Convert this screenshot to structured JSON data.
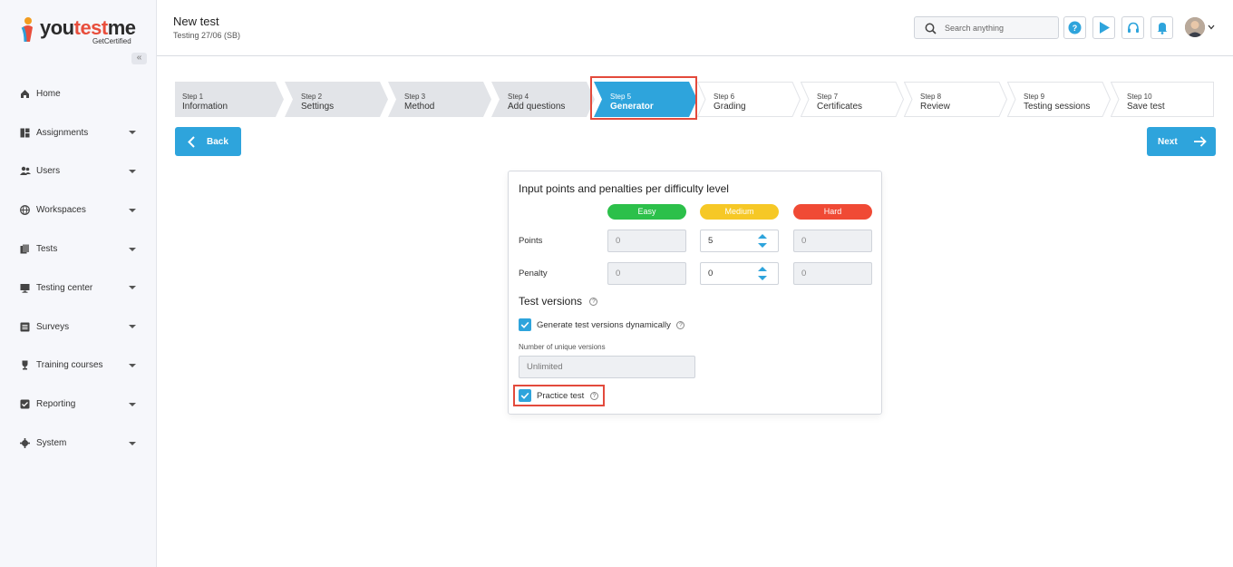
{
  "brand": {
    "word_dark": "you",
    "word_red": "test",
    "word_dark2": "me",
    "tagline": "GetCertified"
  },
  "sidebar": {
    "collapse_icon": "«",
    "items": [
      {
        "label": "Home",
        "icon": "home-icon",
        "has_caret": false
      },
      {
        "label": "Assignments",
        "icon": "assignments-icon",
        "has_caret": true
      },
      {
        "label": "Users",
        "icon": "users-icon",
        "has_caret": true
      },
      {
        "label": "Workspaces",
        "icon": "globe-icon",
        "has_caret": true
      },
      {
        "label": "Tests",
        "icon": "tests-icon",
        "has_caret": true
      },
      {
        "label": "Testing center",
        "icon": "monitor-icon",
        "has_caret": true
      },
      {
        "label": "Surveys",
        "icon": "surveys-icon",
        "has_caret": true
      },
      {
        "label": "Training courses",
        "icon": "trophy-icon",
        "has_caret": true
      },
      {
        "label": "Reporting",
        "icon": "reporting-icon",
        "has_caret": true
      },
      {
        "label": "System",
        "icon": "gear-icon",
        "has_caret": true
      }
    ]
  },
  "header": {
    "title": "New test",
    "subtitle": "Testing 27/06 (SB)",
    "search_placeholder": "Search anything"
  },
  "stepper": {
    "active_index": 4,
    "steps": [
      {
        "num": "Step 1",
        "name": "Information"
      },
      {
        "num": "Step 2",
        "name": "Settings"
      },
      {
        "num": "Step 3",
        "name": "Method"
      },
      {
        "num": "Step 4",
        "name": "Add questions"
      },
      {
        "num": "Step 5",
        "name": "Generator"
      },
      {
        "num": "Step 6",
        "name": "Grading"
      },
      {
        "num": "Step 7",
        "name": "Certificates"
      },
      {
        "num": "Step 8",
        "name": "Review"
      },
      {
        "num": "Step 9",
        "name": "Testing sessions"
      },
      {
        "num": "Step 10",
        "name": "Save test"
      }
    ]
  },
  "nav_buttons": {
    "back": "Back",
    "next": "Next"
  },
  "card": {
    "title": "Input points and penalties per difficulty level",
    "levels": {
      "easy": "Easy",
      "medium": "Medium",
      "hard": "Hard"
    },
    "points_label": "Points",
    "penalty_label": "Penalty",
    "points": {
      "easy": "0",
      "medium": "5",
      "hard": "0"
    },
    "penalty": {
      "easy": "0",
      "medium": "0",
      "hard": "0"
    },
    "versions_title": "Test versions",
    "dynamic_label": "Generate test versions dynamically",
    "dynamic_checked": true,
    "unique_label": "Number of unique versions",
    "unique_value": "Unlimited",
    "practice_label": "Practice test",
    "practice_checked": true
  },
  "colors": {
    "accent": "#2ea4dc",
    "easy": "#2cc04a",
    "medium": "#f6c826",
    "hard": "#f04a35",
    "highlight": "#e34a3c"
  }
}
